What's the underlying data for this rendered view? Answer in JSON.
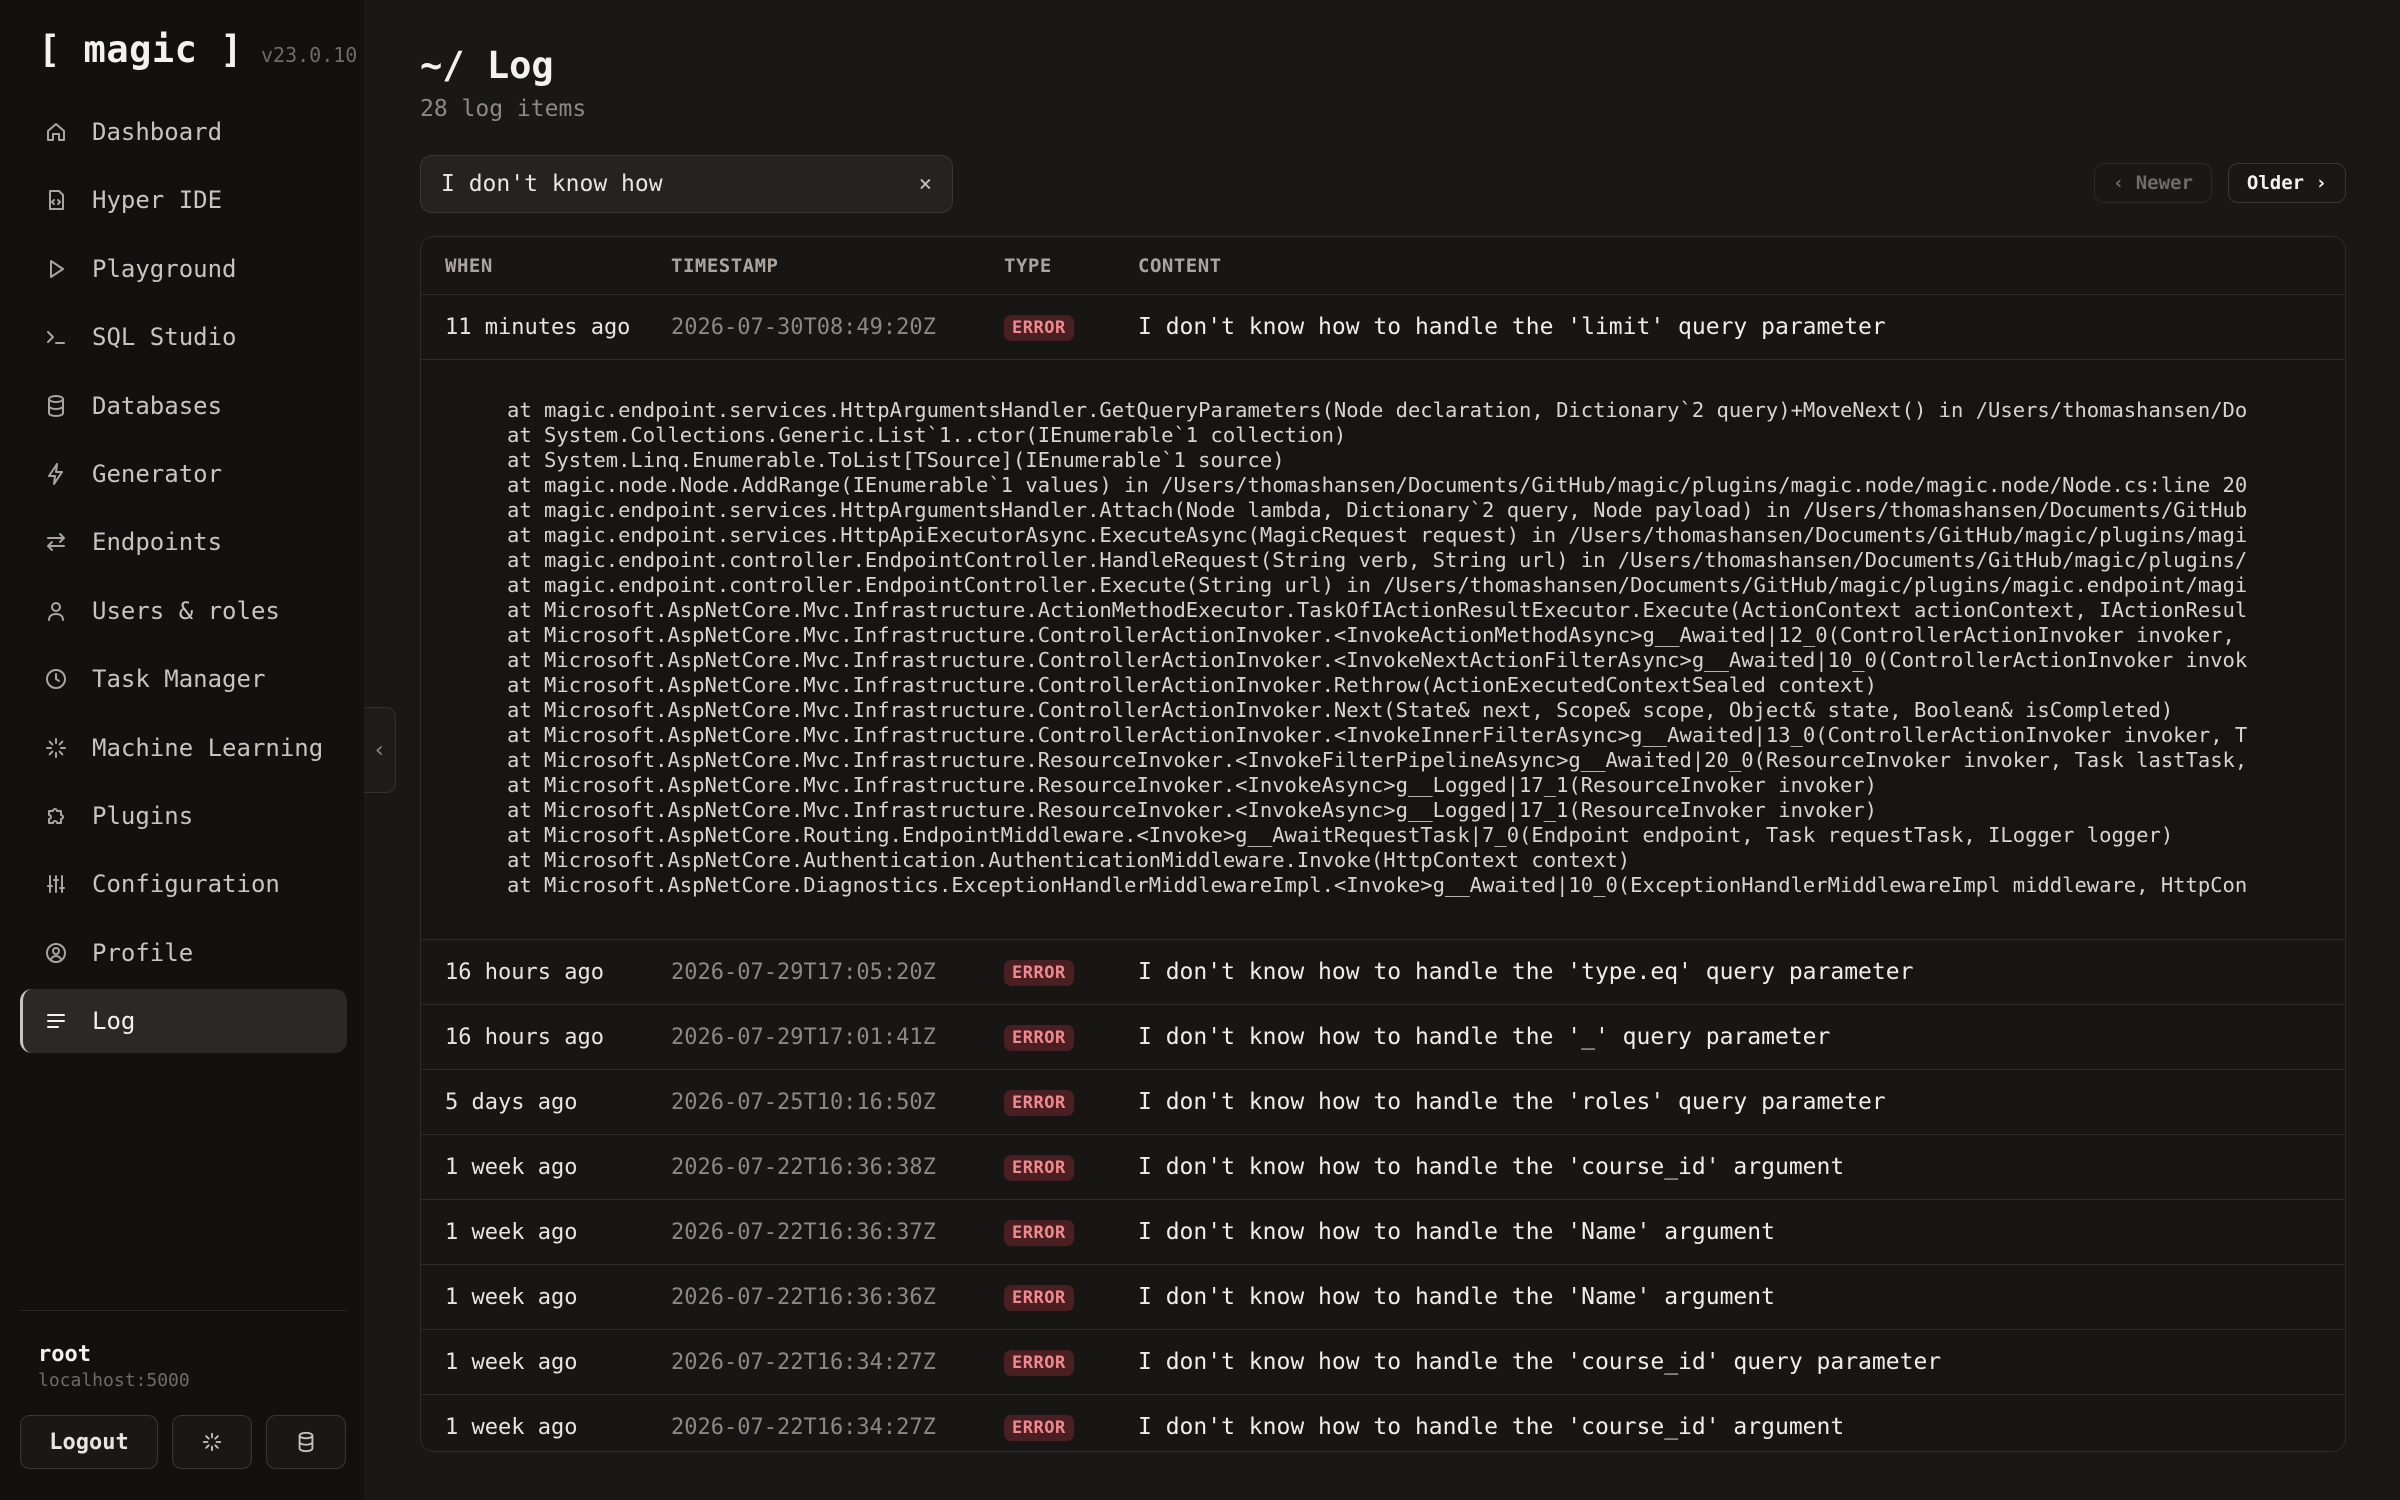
{
  "sidebar": {
    "brand": "[ magic ]",
    "version": "v23.0.10",
    "items": [
      {
        "label": "Dashboard",
        "icon": "home-icon"
      },
      {
        "label": "Hyper IDE",
        "icon": "file-code-icon"
      },
      {
        "label": "Playground",
        "icon": "play-icon"
      },
      {
        "label": "SQL Studio",
        "icon": "terminal-icon"
      },
      {
        "label": "Databases",
        "icon": "database-icon"
      },
      {
        "label": "Generator",
        "icon": "bolt-icon"
      },
      {
        "label": "Endpoints",
        "icon": "arrows-exchange-icon"
      },
      {
        "label": "Users & roles",
        "icon": "user-icon"
      },
      {
        "label": "Task Manager",
        "icon": "clock-icon"
      },
      {
        "label": "Machine Learning",
        "icon": "sparkle-icon"
      },
      {
        "label": "Plugins",
        "icon": "puzzle-icon"
      },
      {
        "label": "Configuration",
        "icon": "sliders-icon"
      },
      {
        "label": "Profile",
        "icon": "user-circle-icon"
      },
      {
        "label": "Log",
        "icon": "list-icon",
        "active": true
      }
    ],
    "user": "root",
    "host": "localhost:5000",
    "logout_label": "Logout"
  },
  "header": {
    "title": "~/ Log",
    "subtitle": "28 log items"
  },
  "search": {
    "value": "I don't know how",
    "clear_glyph": "×"
  },
  "pager": {
    "newer": "‹ Newer",
    "older": "Older ›"
  },
  "table": {
    "columns": [
      "WHEN",
      "TIMESTAMP",
      "TYPE",
      "CONTENT"
    ],
    "rows": [
      {
        "when": "11 minutes ago",
        "timestamp": "2026-07-30T08:49:20Z",
        "type": "ERROR",
        "content": "I don't know how to handle the 'limit' query parameter",
        "expanded": true
      },
      {
        "when": "16 hours ago",
        "timestamp": "2026-07-29T17:05:20Z",
        "type": "ERROR",
        "content": "I don't know how to handle the 'type.eq' query parameter"
      },
      {
        "when": "16 hours ago",
        "timestamp": "2026-07-29T17:01:41Z",
        "type": "ERROR",
        "content": "I don't know how to handle the '_' query parameter"
      },
      {
        "when": "5 days ago",
        "timestamp": "2026-07-25T10:16:50Z",
        "type": "ERROR",
        "content": "I don't know how to handle the 'roles' query parameter"
      },
      {
        "when": "1 week ago",
        "timestamp": "2026-07-22T16:36:38Z",
        "type": "ERROR",
        "content": "I don't know how to handle the 'course_id' argument"
      },
      {
        "when": "1 week ago",
        "timestamp": "2026-07-22T16:36:37Z",
        "type": "ERROR",
        "content": "I don't know how to handle the 'Name' argument"
      },
      {
        "when": "1 week ago",
        "timestamp": "2026-07-22T16:36:36Z",
        "type": "ERROR",
        "content": "I don't know how to handle the 'Name' argument"
      },
      {
        "when": "1 week ago",
        "timestamp": "2026-07-22T16:34:27Z",
        "type": "ERROR",
        "content": "I don't know how to handle the 'course_id' query parameter"
      },
      {
        "when": "1 week ago",
        "timestamp": "2026-07-22T16:34:27Z",
        "type": "ERROR",
        "content": "I don't know how to handle the 'course_id' argument"
      }
    ],
    "stacktrace": [
      "at magic.endpoint.services.HttpArgumentsHandler.GetQueryParameters(Node declaration, Dictionary`2 query)+MoveNext() in /Users/thomashansen/Do",
      "at System.Collections.Generic.List`1..ctor(IEnumerable`1 collection)",
      "at System.Linq.Enumerable.ToList[TSource](IEnumerable`1 source)",
      "at magic.node.Node.AddRange(IEnumerable`1 values) in /Users/thomashansen/Documents/GitHub/magic/plugins/magic.node/magic.node/Node.cs:line 20",
      "at magic.endpoint.services.HttpArgumentsHandler.Attach(Node lambda, Dictionary`2 query, Node payload) in /Users/thomashansen/Documents/GitHub",
      "at magic.endpoint.services.HttpApiExecutorAsync.ExecuteAsync(MagicRequest request) in /Users/thomashansen/Documents/GitHub/magic/plugins/magi",
      "at magic.endpoint.controller.EndpointController.HandleRequest(String verb, String url) in /Users/thomashansen/Documents/GitHub/magic/plugins/",
      "at magic.endpoint.controller.EndpointController.Execute(String url) in /Users/thomashansen/Documents/GitHub/magic/plugins/magic.endpoint/magi",
      "at Microsoft.AspNetCore.Mvc.Infrastructure.ActionMethodExecutor.TaskOfIActionResultExecutor.Execute(ActionContext actionContext, IActionResul",
      "at Microsoft.AspNetCore.Mvc.Infrastructure.ControllerActionInvoker.<InvokeActionMethodAsync>g__Awaited|12_0(ControllerActionInvoker invoker,",
      "at Microsoft.AspNetCore.Mvc.Infrastructure.ControllerActionInvoker.<InvokeNextActionFilterAsync>g__Awaited|10_0(ControllerActionInvoker invok",
      "at Microsoft.AspNetCore.Mvc.Infrastructure.ControllerActionInvoker.Rethrow(ActionExecutedContextSealed context)",
      "at Microsoft.AspNetCore.Mvc.Infrastructure.ControllerActionInvoker.Next(State& next, Scope& scope, Object& state, Boolean& isCompleted)",
      "at Microsoft.AspNetCore.Mvc.Infrastructure.ControllerActionInvoker.<InvokeInnerFilterAsync>g__Awaited|13_0(ControllerActionInvoker invoker, T",
      "at Microsoft.AspNetCore.Mvc.Infrastructure.ResourceInvoker.<InvokeFilterPipelineAsync>g__Awaited|20_0(ResourceInvoker invoker, Task lastTask,",
      "at Microsoft.AspNetCore.Mvc.Infrastructure.ResourceInvoker.<InvokeAsync>g__Logged|17_1(ResourceInvoker invoker)",
      "at Microsoft.AspNetCore.Mvc.Infrastructure.ResourceInvoker.<InvokeAsync>g__Logged|17_1(ResourceInvoker invoker)",
      "at Microsoft.AspNetCore.Routing.EndpointMiddleware.<Invoke>g__AwaitRequestTask|7_0(Endpoint endpoint, Task requestTask, ILogger logger)",
      "at Microsoft.AspNetCore.Authentication.AuthenticationMiddleware.Invoke(HttpContext context)",
      "at Microsoft.AspNetCore.Diagnostics.ExceptionHandlerMiddlewareImpl.<Invoke>g__Awaited|10_0(ExceptionHandlerMiddlewareImpl middleware, HttpCon"
    ]
  },
  "colors": {
    "background": "#1a1817",
    "sidebar": "#131110",
    "error_badge_bg": "#4a1f22",
    "error_badge_text": "#f08a8f"
  }
}
